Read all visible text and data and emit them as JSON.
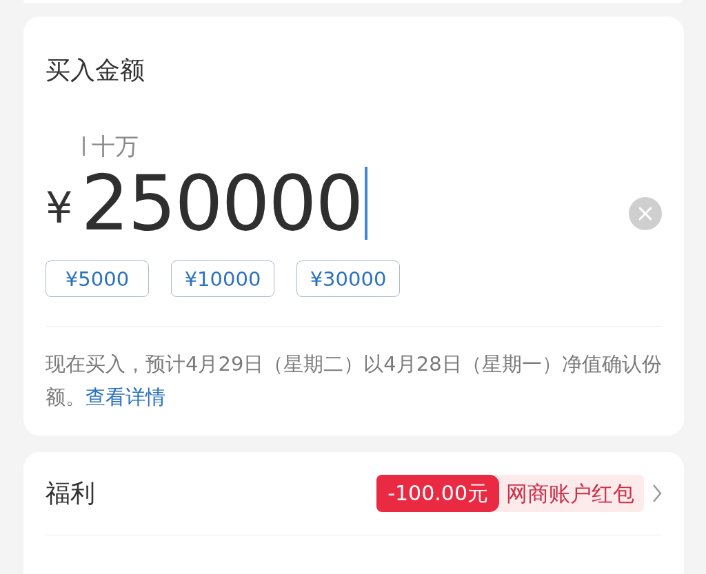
{
  "amount_card": {
    "title": "买入金额",
    "unit_hint": "十万",
    "currency": "¥",
    "value": "250000",
    "quick_amounts": [
      "¥5000",
      "¥10000",
      "¥30000"
    ],
    "note": "现在买入，预计4月29日（星期二）以4月28日（星期一）净值确认份额。",
    "note_link": "查看详情"
  },
  "benefit_card": {
    "title": "福利",
    "discount": "-100.00元",
    "coupon": "网商账户红包"
  }
}
